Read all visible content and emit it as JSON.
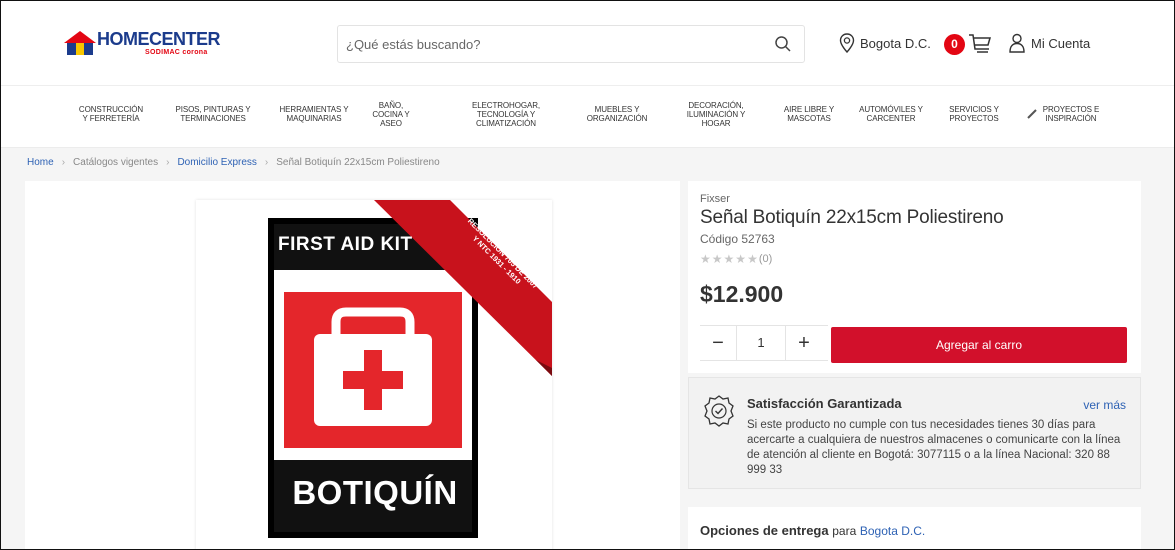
{
  "header": {
    "brand": "HOMECENTER",
    "brand_sub": "SODIMAC corona",
    "search_placeholder": "¿Qué estás buscando?",
    "location": "Bogota D.C.",
    "cart_count": "0",
    "account_label": "Mi Cuenta"
  },
  "nav": {
    "items": [
      {
        "lines": [
          "CONSTRUCCIÓN",
          "Y FERRETERÍA"
        ]
      },
      {
        "lines": [
          "PISOS, PINTURAS Y",
          "TERMINACIONES"
        ]
      },
      {
        "lines": [
          "HERRAMIENTAS Y",
          "MAQUINARIAS"
        ]
      },
      {
        "lines": [
          "BAÑO,",
          "COCINA Y",
          "ASEO"
        ]
      },
      {
        "lines": [
          "ELECTROHOGAR,",
          "TECNOLOGÍA Y",
          "CLIMATIZACIÓN"
        ]
      },
      {
        "lines": [
          "MUEBLES Y",
          "ORGANIZACIÓN"
        ]
      },
      {
        "lines": [
          "DECORACIÓN,",
          "ILUMINACIÓN Y",
          "HOGAR"
        ]
      },
      {
        "lines": [
          "AIRE LIBRE Y",
          "MASCOTAS"
        ]
      },
      {
        "lines": [
          "AUTOMÓVILES Y",
          "CARCENTER"
        ]
      },
      {
        "lines": [
          "SERVICIOS Y",
          "PROYECTOS"
        ]
      },
      {
        "lines": [
          "PROYECTOS E",
          "INSPIRACIÓN"
        ]
      }
    ]
  },
  "breadcrumb": {
    "home": "Home",
    "catalogs": "Catálogos vigentes",
    "category": "Domicilio Express",
    "current": "Señal Botiquín 22x15cm Poliestireno"
  },
  "product_image": {
    "top_text": "FIRST AID KIT",
    "bottom_text": "BOTIQUÍN",
    "ribbon_lines": [
      "CUMPLE CON",
      "RESOLUCIÓN 705 DE 2007",
      "Y NTC 1931 - 1910"
    ]
  },
  "product": {
    "brand": "Fixser",
    "title": "Señal Botiquín 22x15cm Poliestireno",
    "code": "Código 52763",
    "rating_count": "(0)",
    "rating": 0,
    "price": "$12.900",
    "quantity": "1",
    "add_to_cart": "Agregar al carro"
  },
  "guarantee": {
    "title": "Satisfacción Garantizada",
    "more": "ver más",
    "text": "Si este producto no cumple con tus necesidades tienes 30 días para acercarte a cualquiera de nuestros almacenes o comunicarte con la línea de atención al cliente en Bogotá: 3077115 o a la línea Nacional: 320 88 999 33"
  },
  "delivery": {
    "title": "Opciones de entrega",
    "para": "para",
    "city": "Bogota D.C."
  },
  "colors": {
    "accent_red": "#d2102b",
    "link_blue": "#2e62b4",
    "brand_blue": "#1b3b8c"
  }
}
